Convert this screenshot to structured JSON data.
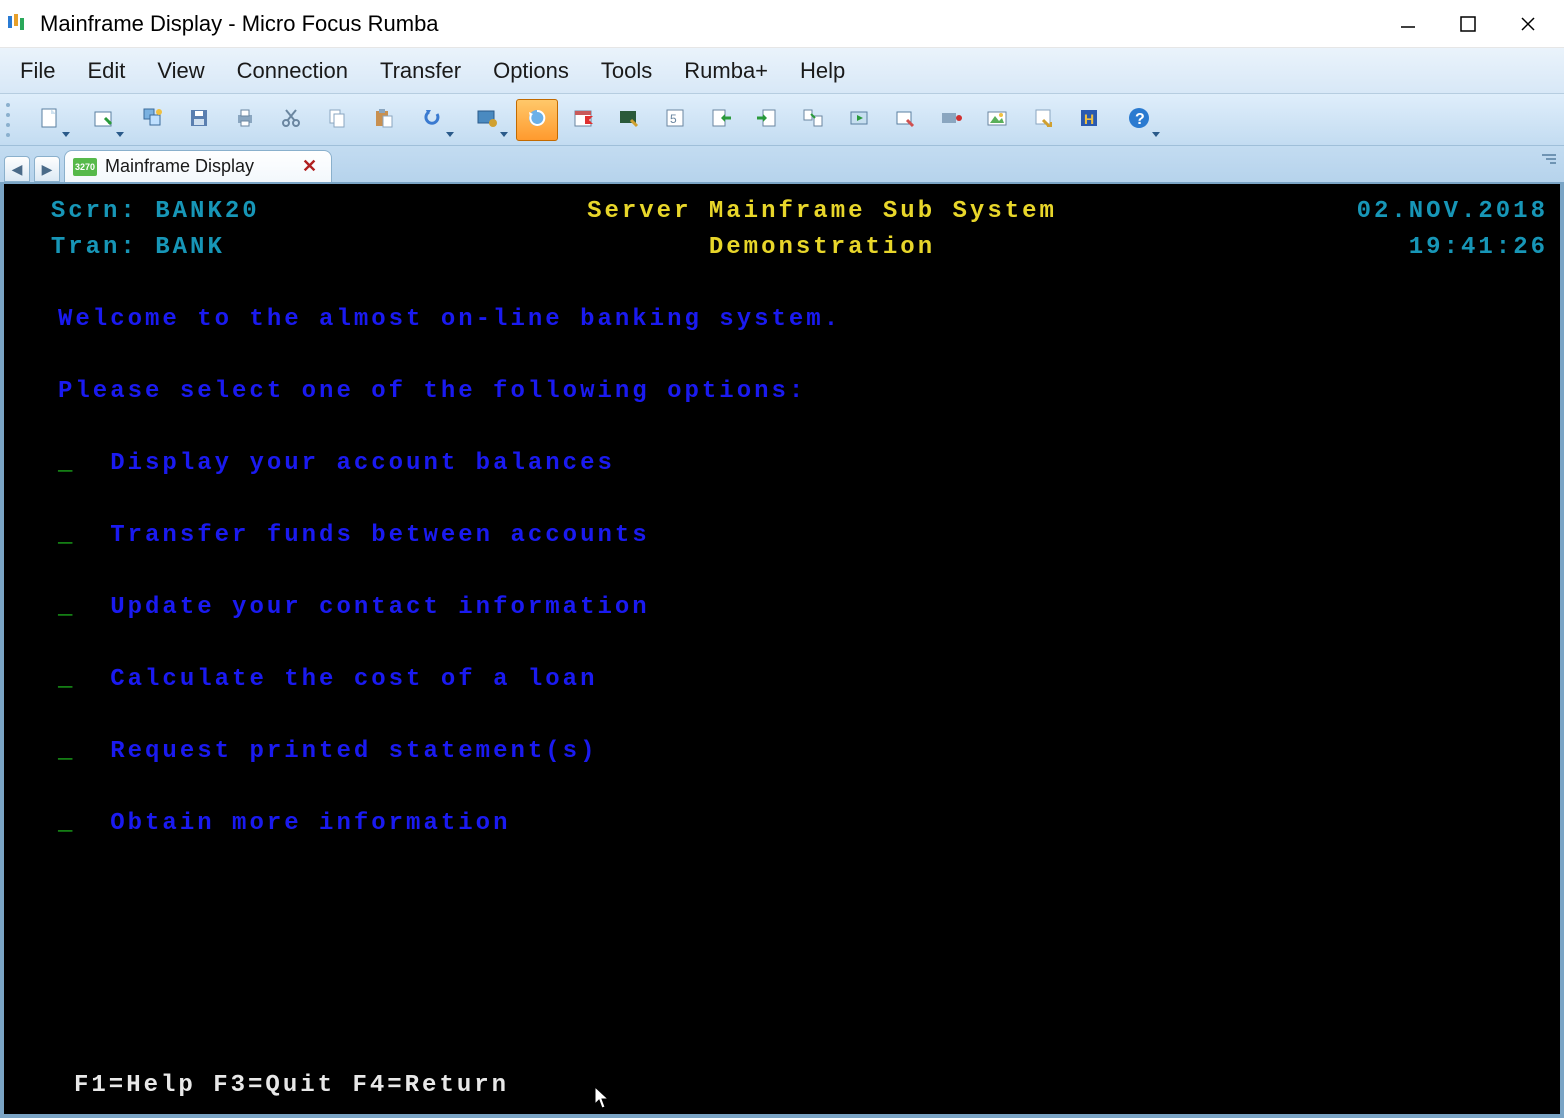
{
  "window": {
    "title": "Mainframe Display - Micro Focus Rumba"
  },
  "menu": {
    "items": [
      "File",
      "Edit",
      "View",
      "Connection",
      "Transfer",
      "Options",
      "Tools",
      "Rumba+",
      "Help"
    ]
  },
  "toolbar": {
    "icons": [
      {
        "name": "new-document-icon",
        "dd": true
      },
      {
        "name": "open-recent-icon",
        "dd": true
      },
      {
        "name": "window-arrange-icon"
      },
      {
        "name": "save-icon"
      },
      {
        "name": "print-icon"
      },
      {
        "name": "cut-icon"
      },
      {
        "name": "copy-icon"
      },
      {
        "name": "paste-icon"
      },
      {
        "name": "undo-icon",
        "dd": true
      },
      {
        "name": "screen-settings-icon",
        "dd": true
      },
      {
        "name": "refresh-icon",
        "active": true
      },
      {
        "name": "calendar-flag-icon"
      },
      {
        "name": "display-edit-icon"
      },
      {
        "name": "keypad-icon"
      },
      {
        "name": "import-icon"
      },
      {
        "name": "export-icon"
      },
      {
        "name": "transfer-queue-icon"
      },
      {
        "name": "macro-play-icon"
      },
      {
        "name": "macro-edit-icon"
      },
      {
        "name": "record-icon"
      },
      {
        "name": "photo-icon"
      },
      {
        "name": "cleanup-icon"
      },
      {
        "name": "history-icon"
      },
      {
        "name": "help-icon",
        "dd": true
      }
    ]
  },
  "tab": {
    "badge": "3270",
    "title": "Mainframe Display"
  },
  "screen": {
    "scrn_label": "Scrn:",
    "scrn_value": "BANK20",
    "tran_label": "Tran:",
    "tran_value": "BANK",
    "header1": "Server Mainframe Sub System",
    "header2": "Demonstration",
    "date": "02.NOV.2018",
    "time": "19:41:26",
    "welcome": "Welcome to the almost on-line banking system.",
    "prompt": "Please select one of the following options:",
    "options": [
      "Display your account balances",
      "Transfer funds between accounts",
      "Update your contact information",
      "Calculate the cost of a loan",
      "Request printed statement(s)",
      "Obtain more information"
    ],
    "fkeys": "F1=Help F3=Quit F4=Return"
  }
}
